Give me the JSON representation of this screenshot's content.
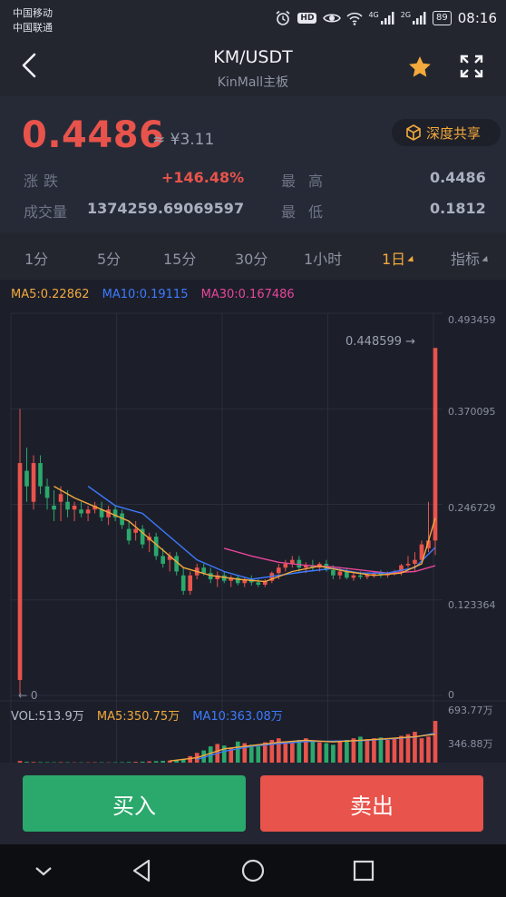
{
  "status_bar": {
    "carrier1": "中国移动",
    "carrier2": "中国联通",
    "signal1": "4G",
    "signal2": "2G",
    "battery": "89",
    "time": "08:16",
    "icons": [
      "alarm-icon",
      "hd-icon",
      "eye-icon",
      "wifi-icon",
      "signal-icon",
      "battery-icon"
    ]
  },
  "header": {
    "title": "KM/USDT",
    "subtitle": "KinMall主板",
    "star_color": "#f3a93c"
  },
  "price": {
    "last": "0.4486",
    "cny": "≈ ¥3.11",
    "depth_button": "深度共享",
    "change_label": "涨跌",
    "change_value": "+146.48%",
    "high_label": "最高",
    "high_value": "0.4486",
    "volume_label": "成交量",
    "volume_value": "1374259.69069597",
    "low_label": "最低",
    "low_value": "0.1812"
  },
  "tabs": [
    {
      "label": "1分",
      "active": false
    },
    {
      "label": "5分",
      "active": false
    },
    {
      "label": "15分",
      "active": false
    },
    {
      "label": "30分",
      "active": false
    },
    {
      "label": "1小时",
      "active": false
    },
    {
      "label": "1日",
      "active": true
    },
    {
      "label": "指标",
      "active": false
    }
  ],
  "chart": {
    "ma5": "MA5:0.22862",
    "ma10": "MA10:0.19115",
    "ma30": "MA30:0.167486",
    "last_price_marker": "0.448599 →",
    "low_marker": "← 0",
    "vol_label": "VOL:513.9万",
    "vol_ma5": "MA5:350.75万",
    "vol_ma10": "MA10:363.08万",
    "axis_ticks": [
      "0.493459",
      "0.370095",
      "0.246729",
      "0.123364",
      "0"
    ],
    "vol_axis_ticks": [
      "693.77万",
      "346.88万"
    ],
    "colors": {
      "up": "#e8534b",
      "down": "#2ba86c",
      "ma5": "#f3a93c",
      "ma10": "#3d7bff",
      "ma30": "#e8459b"
    }
  },
  "chart_data": {
    "type": "candlestick",
    "y_range": [
      0,
      0.493459
    ],
    "volume_range": [
      0,
      693.77
    ],
    "candles": [
      {
        "o": 0.02,
        "h": 0.37,
        "l": 0.0,
        "c": 0.3
      },
      {
        "o": 0.29,
        "h": 0.32,
        "l": 0.25,
        "c": 0.27
      },
      {
        "o": 0.25,
        "h": 0.31,
        "l": 0.24,
        "c": 0.3
      },
      {
        "o": 0.3,
        "h": 0.31,
        "l": 0.26,
        "c": 0.27
      },
      {
        "o": 0.27,
        "h": 0.28,
        "l": 0.24,
        "c": 0.255
      },
      {
        "o": 0.245,
        "h": 0.265,
        "l": 0.225,
        "c": 0.24
      },
      {
        "o": 0.25,
        "h": 0.27,
        "l": 0.225,
        "c": 0.26
      },
      {
        "o": 0.25,
        "h": 0.265,
        "l": 0.23,
        "c": 0.24
      },
      {
        "o": 0.24,
        "h": 0.25,
        "l": 0.225,
        "c": 0.245
      },
      {
        "o": 0.24,
        "h": 0.25,
        "l": 0.23,
        "c": 0.235
      },
      {
        "o": 0.235,
        "h": 0.245,
        "l": 0.225,
        "c": 0.24
      },
      {
        "o": 0.24,
        "h": 0.25,
        "l": 0.235,
        "c": 0.245
      },
      {
        "o": 0.24,
        "h": 0.25,
        "l": 0.225,
        "c": 0.23
      },
      {
        "o": 0.23,
        "h": 0.245,
        "l": 0.22,
        "c": 0.24
      },
      {
        "o": 0.24,
        "h": 0.245,
        "l": 0.225,
        "c": 0.23
      },
      {
        "o": 0.235,
        "h": 0.24,
        "l": 0.215,
        "c": 0.22
      },
      {
        "o": 0.215,
        "h": 0.225,
        "l": 0.195,
        "c": 0.2
      },
      {
        "o": 0.21,
        "h": 0.225,
        "l": 0.2,
        "c": 0.215
      },
      {
        "o": 0.215,
        "h": 0.22,
        "l": 0.19,
        "c": 0.195
      },
      {
        "o": 0.2,
        "h": 0.21,
        "l": 0.185,
        "c": 0.205
      },
      {
        "o": 0.205,
        "h": 0.21,
        "l": 0.175,
        "c": 0.18
      },
      {
        "o": 0.18,
        "h": 0.19,
        "l": 0.165,
        "c": 0.17
      },
      {
        "o": 0.175,
        "h": 0.185,
        "l": 0.16,
        "c": 0.18
      },
      {
        "o": 0.18,
        "h": 0.185,
        "l": 0.155,
        "c": 0.16
      },
      {
        "o": 0.155,
        "h": 0.165,
        "l": 0.13,
        "c": 0.135
      },
      {
        "o": 0.135,
        "h": 0.16,
        "l": 0.13,
        "c": 0.155
      },
      {
        "o": 0.155,
        "h": 0.17,
        "l": 0.15,
        "c": 0.165
      },
      {
        "o": 0.165,
        "h": 0.17,
        "l": 0.155,
        "c": 0.158
      },
      {
        "o": 0.158,
        "h": 0.165,
        "l": 0.145,
        "c": 0.15
      },
      {
        "o": 0.15,
        "h": 0.16,
        "l": 0.14,
        "c": 0.155
      },
      {
        "o": 0.155,
        "h": 0.16,
        "l": 0.145,
        "c": 0.148
      },
      {
        "o": 0.148,
        "h": 0.155,
        "l": 0.14,
        "c": 0.152
      },
      {
        "o": 0.152,
        "h": 0.155,
        "l": 0.142,
        "c": 0.145
      },
      {
        "o": 0.145,
        "h": 0.152,
        "l": 0.14,
        "c": 0.15
      },
      {
        "o": 0.15,
        "h": 0.155,
        "l": 0.142,
        "c": 0.146
      },
      {
        "o": 0.146,
        "h": 0.15,
        "l": 0.14,
        "c": 0.143
      },
      {
        "o": 0.143,
        "h": 0.15,
        "l": 0.14,
        "c": 0.148
      },
      {
        "o": 0.148,
        "h": 0.16,
        "l": 0.145,
        "c": 0.158
      },
      {
        "o": 0.158,
        "h": 0.17,
        "l": 0.15,
        "c": 0.165
      },
      {
        "o": 0.165,
        "h": 0.175,
        "l": 0.16,
        "c": 0.17
      },
      {
        "o": 0.17,
        "h": 0.18,
        "l": 0.165,
        "c": 0.175
      },
      {
        "o": 0.175,
        "h": 0.18,
        "l": 0.16,
        "c": 0.165
      },
      {
        "o": 0.165,
        "h": 0.172,
        "l": 0.158,
        "c": 0.168
      },
      {
        "o": 0.168,
        "h": 0.175,
        "l": 0.16,
        "c": 0.165
      },
      {
        "o": 0.165,
        "h": 0.172,
        "l": 0.16,
        "c": 0.17
      },
      {
        "o": 0.17,
        "h": 0.175,
        "l": 0.16,
        "c": 0.162
      },
      {
        "o": 0.162,
        "h": 0.168,
        "l": 0.15,
        "c": 0.155
      },
      {
        "o": 0.155,
        "h": 0.165,
        "l": 0.15,
        "c": 0.16
      },
      {
        "o": 0.16,
        "h": 0.165,
        "l": 0.15,
        "c": 0.152
      },
      {
        "o": 0.152,
        "h": 0.158,
        "l": 0.148,
        "c": 0.155
      },
      {
        "o": 0.155,
        "h": 0.16,
        "l": 0.15,
        "c": 0.153
      },
      {
        "o": 0.153,
        "h": 0.158,
        "l": 0.15,
        "c": 0.156
      },
      {
        "o": 0.156,
        "h": 0.16,
        "l": 0.152,
        "c": 0.158
      },
      {
        "o": 0.158,
        "h": 0.162,
        "l": 0.152,
        "c": 0.155
      },
      {
        "o": 0.155,
        "h": 0.16,
        "l": 0.152,
        "c": 0.157
      },
      {
        "o": 0.157,
        "h": 0.162,
        "l": 0.155,
        "c": 0.16
      },
      {
        "o": 0.16,
        "h": 0.17,
        "l": 0.155,
        "c": 0.168
      },
      {
        "o": 0.168,
        "h": 0.18,
        "l": 0.165,
        "c": 0.17
      },
      {
        "o": 0.17,
        "h": 0.185,
        "l": 0.16,
        "c": 0.175
      },
      {
        "o": 0.175,
        "h": 0.2,
        "l": 0.17,
        "c": 0.195
      },
      {
        "o": 0.19,
        "h": 0.25,
        "l": 0.185,
        "c": 0.2
      },
      {
        "o": 0.2,
        "h": 0.4486,
        "l": 0.1812,
        "c": 0.4486
      }
    ],
    "ma5": [
      [
        5,
        0.27
      ],
      [
        8,
        0.255
      ],
      [
        12,
        0.24
      ],
      [
        16,
        0.225
      ],
      [
        20,
        0.195
      ],
      [
        24,
        0.165
      ],
      [
        28,
        0.155
      ],
      [
        32,
        0.15
      ],
      [
        36,
        0.147
      ],
      [
        40,
        0.16
      ],
      [
        44,
        0.167
      ],
      [
        48,
        0.16
      ],
      [
        52,
        0.155
      ],
      [
        56,
        0.158
      ],
      [
        59,
        0.17
      ],
      [
        61,
        0.229
      ]
    ],
    "ma10": [
      [
        10,
        0.27
      ],
      [
        14,
        0.245
      ],
      [
        18,
        0.235
      ],
      [
        22,
        0.205
      ],
      [
        26,
        0.175
      ],
      [
        30,
        0.16
      ],
      [
        34,
        0.15
      ],
      [
        38,
        0.155
      ],
      [
        42,
        0.16
      ],
      [
        46,
        0.164
      ],
      [
        50,
        0.158
      ],
      [
        54,
        0.158
      ],
      [
        58,
        0.165
      ],
      [
        61,
        0.191
      ]
    ],
    "ma30": [
      [
        30,
        0.19
      ],
      [
        34,
        0.18
      ],
      [
        38,
        0.172
      ],
      [
        42,
        0.168
      ],
      [
        46,
        0.166
      ],
      [
        50,
        0.162
      ],
      [
        54,
        0.158
      ],
      [
        58,
        0.16
      ],
      [
        61,
        0.1675
      ]
    ],
    "volume": [
      20,
      10,
      8,
      6,
      6,
      5,
      6,
      5,
      4,
      4,
      4,
      5,
      5,
      4,
      5,
      6,
      8,
      10,
      12,
      15,
      18,
      22,
      26,
      30,
      45,
      80,
      120,
      150,
      200,
      230,
      210,
      180,
      260,
      240,
      220,
      200,
      250,
      280,
      300,
      260,
      240,
      280,
      300,
      270,
      250,
      240,
      220,
      260,
      280,
      300,
      320,
      290,
      300,
      310,
      280,
      300,
      330,
      350,
      380,
      300,
      320,
      513.9
    ],
    "vol_ma5": [
      [
        22,
        20
      ],
      [
        26,
        60
      ],
      [
        30,
        170
      ],
      [
        34,
        210
      ],
      [
        38,
        250
      ],
      [
        42,
        275
      ],
      [
        46,
        255
      ],
      [
        50,
        275
      ],
      [
        54,
        295
      ],
      [
        58,
        320
      ],
      [
        61,
        350.75
      ]
    ],
    "vol_ma10": [
      [
        26,
        40
      ],
      [
        30,
        140
      ],
      [
        34,
        200
      ],
      [
        38,
        235
      ],
      [
        42,
        260
      ],
      [
        46,
        265
      ],
      [
        50,
        270
      ],
      [
        54,
        290
      ],
      [
        58,
        315
      ],
      [
        61,
        363.08
      ]
    ]
  },
  "actions": {
    "buy": "买入",
    "sell": "卖出"
  }
}
